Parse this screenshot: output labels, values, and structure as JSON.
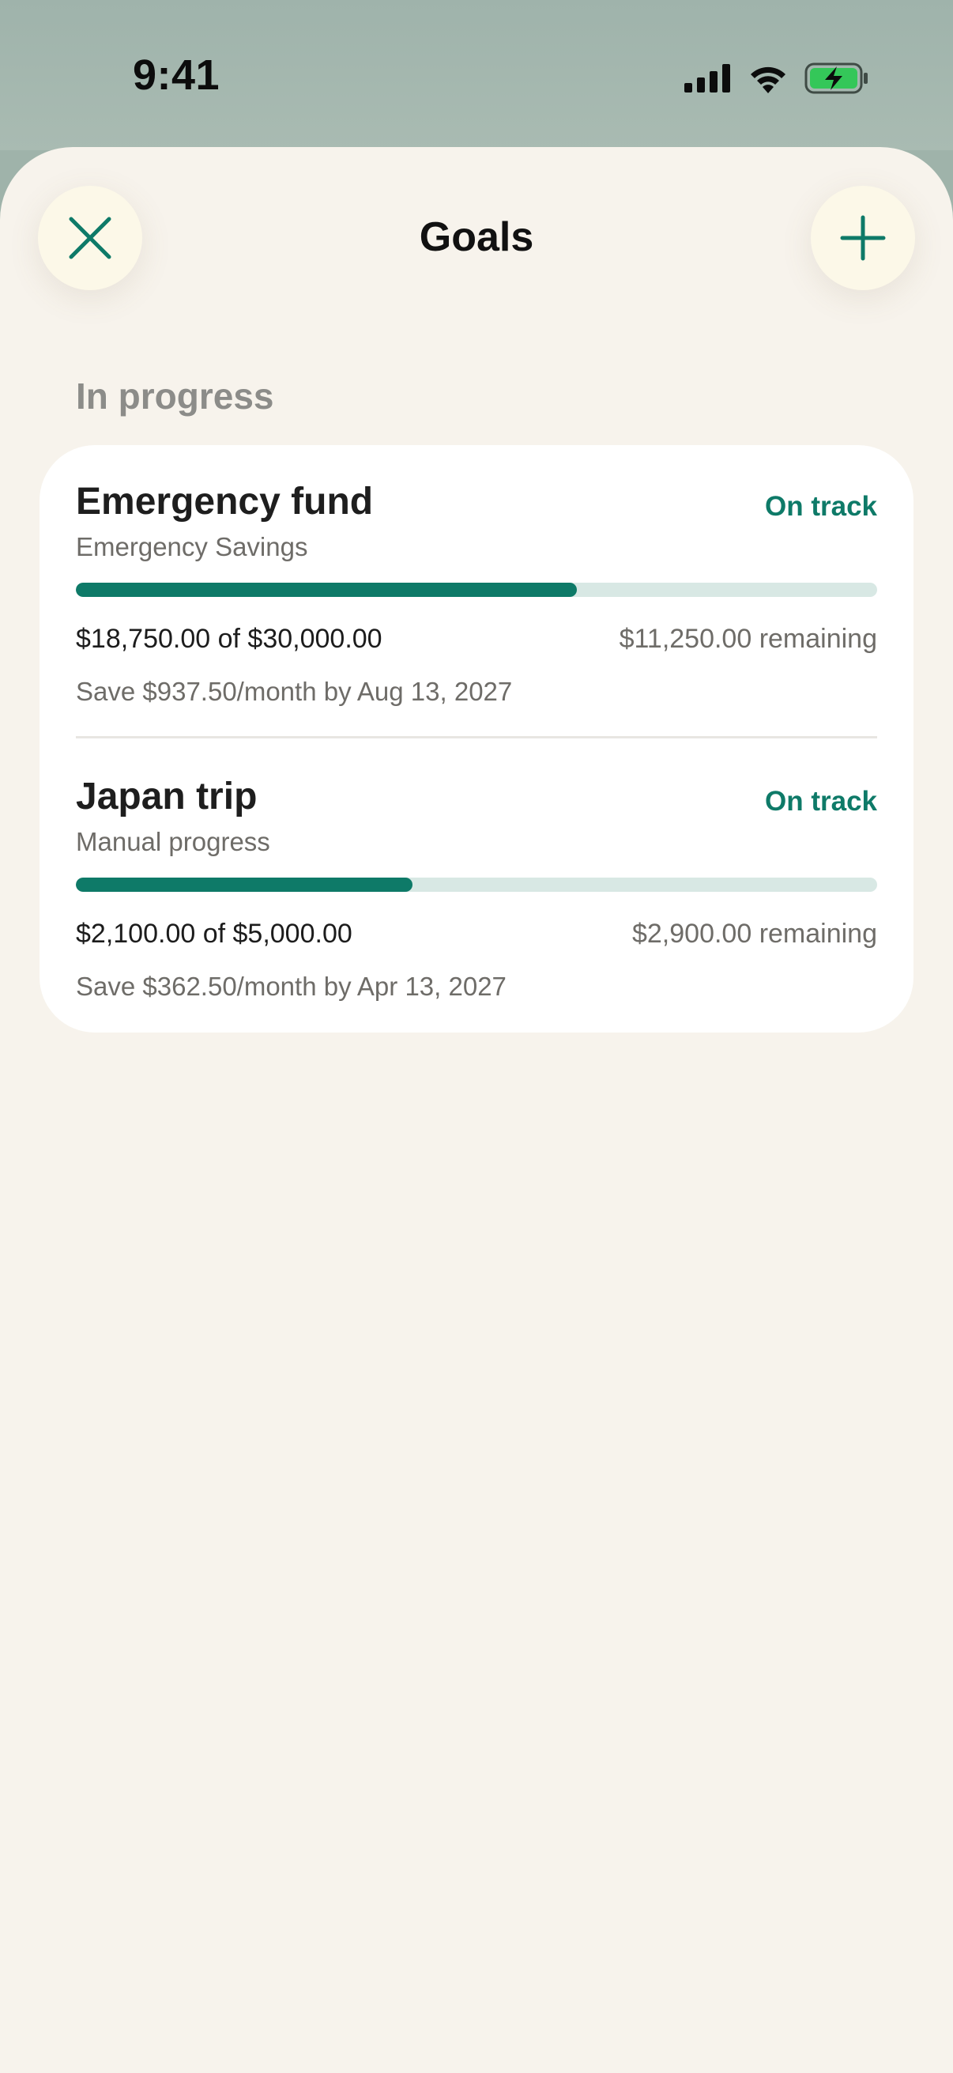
{
  "status_bar": {
    "time": "9:41"
  },
  "header": {
    "title": "Goals",
    "close_icon": "close-icon",
    "add_icon": "plus-icon"
  },
  "section": {
    "title": "In progress"
  },
  "goals": [
    {
      "name": "Emergency fund",
      "status": "On track",
      "source": "Emergency Savings",
      "amount": "$18,750.00 of $30,000.00",
      "remaining": "$11,250.00 remaining",
      "plan": "Save $937.50/month by Aug 13, 2027",
      "progress": 0.625
    },
    {
      "name": "Japan trip",
      "status": "On track",
      "source": "Manual progress",
      "amount": "$2,100.00 of $5,000.00",
      "remaining": "$2,900.00 remaining",
      "plan": "Save $362.50/month by Apr 13, 2027",
      "progress": 0.42
    }
  ],
  "colors": {
    "accent": "#0e7a68",
    "track": "#d8e8e4",
    "sheet_background": "#f7f3ec",
    "button_background": "#fcf8e8"
  }
}
